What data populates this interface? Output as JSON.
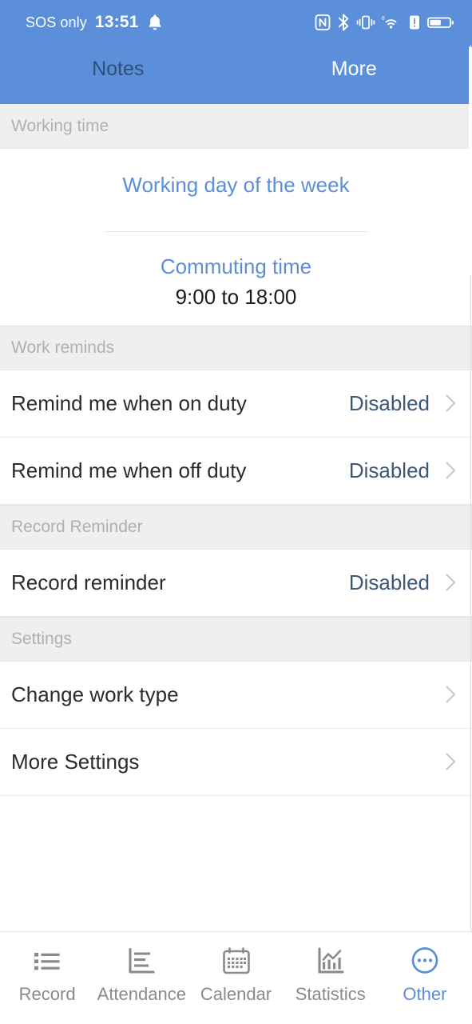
{
  "status_bar": {
    "carrier": "SOS only",
    "clock": "13:51",
    "icons": [
      "bell-icon",
      "nfc-icon",
      "bluetooth-icon",
      "vibrate-icon",
      "wifi-icon",
      "warning-icon",
      "battery-icon"
    ]
  },
  "top_tabs": [
    {
      "label": "Notes",
      "active": false
    },
    {
      "label": "More",
      "active": true
    }
  ],
  "sections": [
    {
      "header": "Working time",
      "type": "worktime",
      "weekday_link": "Working day of the week",
      "commuting_label": "Commuting time",
      "commuting_value": "9:00 to 18:00"
    },
    {
      "header": "Work reminds",
      "type": "rows",
      "rows": [
        {
          "title": "Remind me when on duty",
          "value": "Disabled"
        },
        {
          "title": "Remind me when off duty",
          "value": "Disabled"
        }
      ]
    },
    {
      "header": "Record Reminder",
      "type": "rows",
      "rows": [
        {
          "title": "Record reminder",
          "value": "Disabled"
        }
      ]
    },
    {
      "header": "Settings",
      "type": "rows",
      "rows": [
        {
          "title": "Change work type",
          "value": ""
        },
        {
          "title": "More Settings",
          "value": ""
        }
      ]
    }
  ],
  "bottom_nav": [
    {
      "label": "Record",
      "icon": "list-icon",
      "active": false
    },
    {
      "label": "Attendance",
      "icon": "bar-chart-icon",
      "active": false
    },
    {
      "label": "Calendar",
      "icon": "calendar-icon",
      "active": false
    },
    {
      "label": "Statistics",
      "icon": "stats-icon",
      "active": false
    },
    {
      "label": "Other",
      "icon": "more-dots-icon",
      "active": true
    }
  ],
  "colors": {
    "brand_blue": "#5b8fd9",
    "section_bg": "#efefef",
    "section_text": "#b0b0b0",
    "row_text": "#2b2b2b",
    "value_text": "#3c5878",
    "nav_inactive": "#8a8a8a"
  }
}
